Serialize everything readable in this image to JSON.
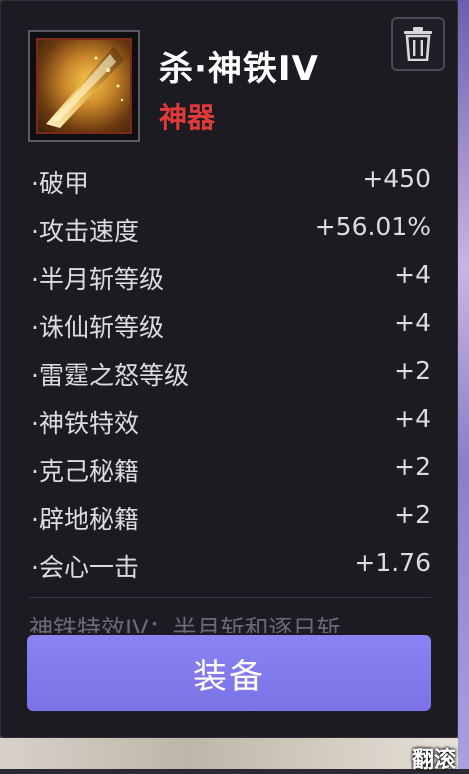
{
  "item": {
    "name": "杀·神铁IV",
    "rarity": "神器",
    "rarity_color": "#e03a3a",
    "icon": "golden-blade-icon"
  },
  "toolbar": {
    "delete_icon": "trash-icon"
  },
  "stats": [
    {
      "label": "·破甲",
      "value": "+450"
    },
    {
      "label": "·攻击速度",
      "value": "+56.01%"
    },
    {
      "label": "·半月斩等级",
      "value": "+4"
    },
    {
      "label": "·诛仙斩等级",
      "value": "+4"
    },
    {
      "label": "·雷霆之怒等级",
      "value": "+2"
    },
    {
      "label": "·神铁特效",
      "value": "+4"
    },
    {
      "label": "·克己秘籍",
      "value": "+2"
    },
    {
      "label": "·辟地秘籍",
      "value": "+2"
    },
    {
      "label": "·会心一击",
      "value": "+1.76"
    }
  ],
  "description": "神铁特效IV：半月斩和逐日斩",
  "actions": {
    "equip_label": "装备",
    "equip_color": "#7a72e6"
  },
  "background": {
    "corner_text": "翻滚"
  }
}
